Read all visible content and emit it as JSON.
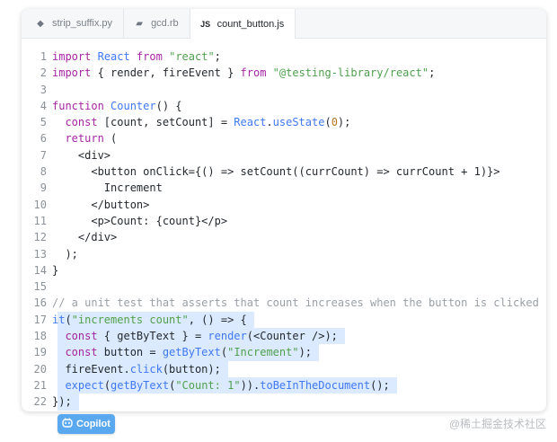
{
  "tabs": [
    {
      "label": "strip_suffix.py",
      "icon": "python-file-icon",
      "glyph": "◆"
    },
    {
      "label": "gcd.rb",
      "icon": "ruby-file-icon",
      "glyph": "▰"
    },
    {
      "label": "count_button.js",
      "icon": "javascript-file-icon",
      "glyph": "JS",
      "active": true
    }
  ],
  "code": {
    "lines": [
      {
        "n": "1",
        "tokens": [
          [
            "kw",
            "import"
          ],
          [
            "pl",
            " "
          ],
          [
            "fn",
            "React"
          ],
          [
            "pl",
            " "
          ],
          [
            "kw",
            "from"
          ],
          [
            "pl",
            " "
          ],
          [
            "str",
            "\"react\""
          ],
          [
            "pl",
            ";"
          ]
        ]
      },
      {
        "n": "2",
        "tokens": [
          [
            "kw",
            "import"
          ],
          [
            "pl",
            " { render, fireEvent } "
          ],
          [
            "kw",
            "from"
          ],
          [
            "pl",
            " "
          ],
          [
            "str",
            "\"@testing-library/react\""
          ],
          [
            "pl",
            ";"
          ]
        ]
      },
      {
        "n": "3",
        "tokens": []
      },
      {
        "n": "4",
        "tokens": [
          [
            "kw",
            "function"
          ],
          [
            "pl",
            " "
          ],
          [
            "fn",
            "Counter"
          ],
          [
            "pl",
            "() {"
          ]
        ]
      },
      {
        "n": "5",
        "tokens": [
          [
            "pl",
            "  "
          ],
          [
            "kw",
            "const"
          ],
          [
            "pl",
            " [count, setCount] = "
          ],
          [
            "fn",
            "React"
          ],
          [
            "pl",
            "."
          ],
          [
            "fn",
            "useState"
          ],
          [
            "pl",
            "("
          ],
          [
            "num",
            "0"
          ],
          [
            "pl",
            ");"
          ]
        ]
      },
      {
        "n": "6",
        "tokens": [
          [
            "pl",
            "  "
          ],
          [
            "kw",
            "return"
          ],
          [
            "pl",
            " ("
          ]
        ]
      },
      {
        "n": "7",
        "tokens": [
          [
            "pl",
            "    <div>"
          ]
        ]
      },
      {
        "n": "8",
        "tokens": [
          [
            "pl",
            "      <button onClick={() => setCount((currCount) => currCount + 1)}>"
          ]
        ]
      },
      {
        "n": "9",
        "tokens": [
          [
            "pl",
            "        Increment"
          ]
        ]
      },
      {
        "n": "10",
        "tokens": [
          [
            "pl",
            "      </button>"
          ]
        ]
      },
      {
        "n": "11",
        "tokens": [
          [
            "pl",
            "      <p>Count: {count}</p>"
          ]
        ]
      },
      {
        "n": "12",
        "tokens": [
          [
            "pl",
            "    </div>"
          ]
        ]
      },
      {
        "n": "13",
        "tokens": [
          [
            "pl",
            "  );"
          ]
        ]
      },
      {
        "n": "14",
        "tokens": [
          [
            "pl",
            "}"
          ]
        ]
      },
      {
        "n": "15",
        "tokens": []
      },
      {
        "n": "16",
        "tokens": [
          [
            "cm",
            "// a unit test that asserts that count increases when the button is clicked"
          ]
        ]
      },
      {
        "n": "17",
        "hl": true,
        "tokens": [
          [
            "fn",
            "it"
          ],
          [
            "pl",
            "("
          ],
          [
            "str",
            "\"increments count\""
          ],
          [
            "pl",
            ", () => {"
          ]
        ]
      },
      {
        "n": "18",
        "hl": true,
        "tokens": [
          [
            "pl",
            "  "
          ],
          [
            "kw",
            "const"
          ],
          [
            "pl",
            " { getByText } = "
          ],
          [
            "fn",
            "render"
          ],
          [
            "pl",
            "(<Counter />);"
          ]
        ]
      },
      {
        "n": "19",
        "hl": true,
        "tokens": [
          [
            "pl",
            "  "
          ],
          [
            "kw",
            "const"
          ],
          [
            "pl",
            " button = "
          ],
          [
            "fn",
            "getByText"
          ],
          [
            "pl",
            "("
          ],
          [
            "str",
            "\"Increment\""
          ],
          [
            "pl",
            ");"
          ]
        ]
      },
      {
        "n": "20",
        "hl": true,
        "tokens": [
          [
            "pl",
            "  fireEvent."
          ],
          [
            "fn",
            "click"
          ],
          [
            "pl",
            "(button);"
          ]
        ]
      },
      {
        "n": "21",
        "hl": true,
        "tokens": [
          [
            "pl",
            "  "
          ],
          [
            "fn",
            "expect"
          ],
          [
            "pl",
            "("
          ],
          [
            "fn",
            "getByText"
          ],
          [
            "pl",
            "("
          ],
          [
            "str",
            "\"Count: 1\""
          ],
          [
            "pl",
            "))."
          ],
          [
            "fn",
            "toBeInTheDocument"
          ],
          [
            "pl",
            "();"
          ]
        ]
      },
      {
        "n": "22",
        "hl": true,
        "tokens": [
          [
            "pl",
            "});"
          ]
        ]
      }
    ]
  },
  "copilot": {
    "label": "Copilot",
    "icon": "copilot-icon"
  },
  "watermark": "@稀土掘金技术社区",
  "colors": {
    "keyword": "#a626a4",
    "function": "#4078f2",
    "string": "#50a14f",
    "number": "#b7791f",
    "comment": "#9aa0a6",
    "highlight": "#dbeafe",
    "copilot_bg": "#5aa9f0"
  }
}
